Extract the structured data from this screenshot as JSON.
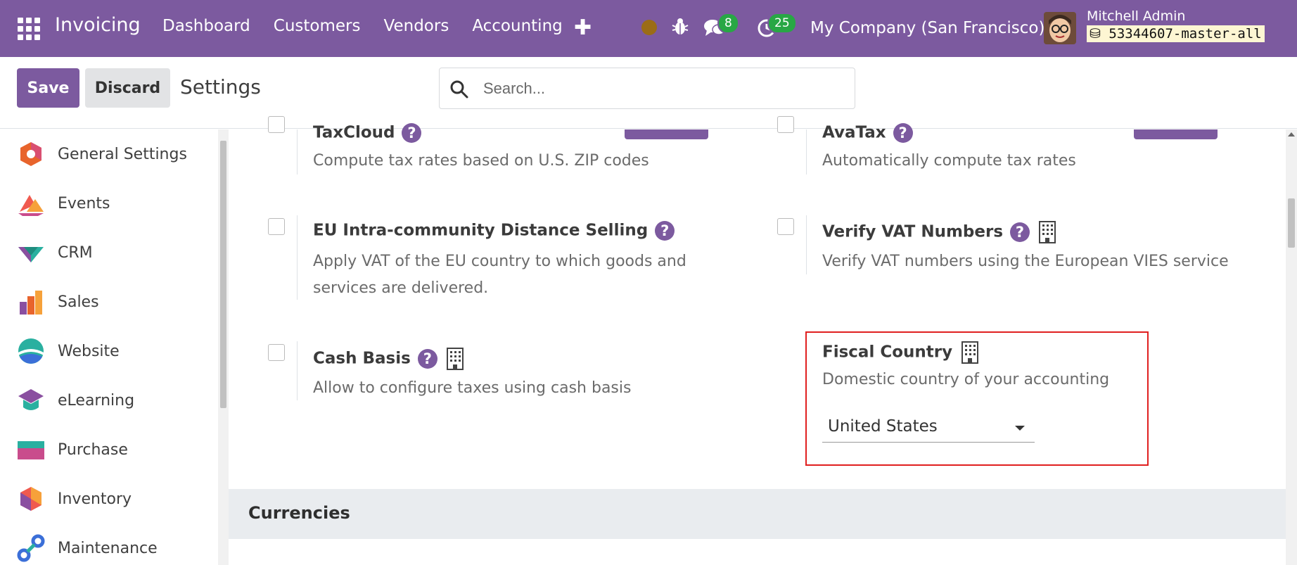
{
  "navbar": {
    "app_name": "Invoicing",
    "menu": [
      "Dashboard",
      "Customers",
      "Vendors",
      "Accounting"
    ],
    "messages_count": "8",
    "activities_count": "25",
    "company": "My Company (San Francisco)",
    "user_name": "Mitchell Admin",
    "database": "53344607-master-all",
    "bg_color": "#7c5a9f"
  },
  "control": {
    "save_label": "Save",
    "discard_label": "Discard",
    "title": "Settings",
    "search_placeholder": "Search..."
  },
  "sidebar": {
    "items": [
      {
        "label": "General Settings",
        "icon": "general-settings-icon"
      },
      {
        "label": "Events",
        "icon": "events-icon"
      },
      {
        "label": "CRM",
        "icon": "crm-icon"
      },
      {
        "label": "Sales",
        "icon": "sales-icon"
      },
      {
        "label": "Website",
        "icon": "website-icon"
      },
      {
        "label": "eLearning",
        "icon": "elearning-icon"
      },
      {
        "label": "Purchase",
        "icon": "purchase-icon"
      },
      {
        "label": "Inventory",
        "icon": "inventory-icon"
      },
      {
        "label": "Maintenance",
        "icon": "maintenance-icon"
      }
    ]
  },
  "settings": {
    "taxcloud": {
      "title": "TaxCloud",
      "desc": "Compute tax rates based on U.S. ZIP codes"
    },
    "avatax": {
      "title": "AvaTax",
      "desc": "Automatically compute tax rates"
    },
    "eu_distance": {
      "title": "EU Intra-community Distance Selling",
      "desc": "Apply VAT of the EU country to which goods and services are delivered."
    },
    "verify_vat": {
      "title": "Verify VAT Numbers",
      "desc": "Verify VAT numbers using the European VIES service"
    },
    "cash_basis": {
      "title": "Cash Basis",
      "desc": "Allow to configure taxes using cash basis"
    },
    "fiscal_country": {
      "title": "Fiscal Country",
      "desc": "Domestic country of your accounting",
      "value": "United States"
    }
  },
  "sections": {
    "currencies": "Currencies"
  },
  "help_glyph": "?"
}
